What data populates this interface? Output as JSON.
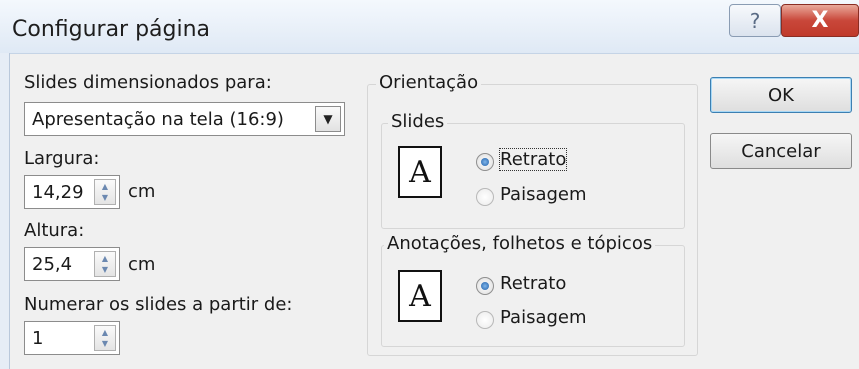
{
  "window": {
    "title": "Configurar página",
    "help_glyph": "?",
    "close_glyph": "X"
  },
  "size": {
    "label": "Slides dimensionados para:",
    "selected": "Apresentação na tela (16:9)",
    "dropdown_glyph": "▼"
  },
  "width": {
    "label": "Largura:",
    "value": "14,29",
    "unit": "cm"
  },
  "height": {
    "label": "Altura:",
    "value": "25,4",
    "unit": "cm"
  },
  "numbering": {
    "label": "Numerar os slides a partir de:",
    "value": "1"
  },
  "spin_glyphs": {
    "up": "▲",
    "down": "▼"
  },
  "orientation": {
    "label": "Orientação",
    "slides": {
      "label": "Slides",
      "icon_letter": "A",
      "portrait": "Retrato",
      "landscape": "Paisagem",
      "selected": "Retrato"
    },
    "notes": {
      "label": "Anotações, folhetos e  tópicos",
      "icon_letter": "A",
      "portrait": "Retrato",
      "landscape": "Paisagem",
      "selected": "Retrato"
    }
  },
  "buttons": {
    "ok": "OK",
    "cancel": "Cancelar"
  }
}
